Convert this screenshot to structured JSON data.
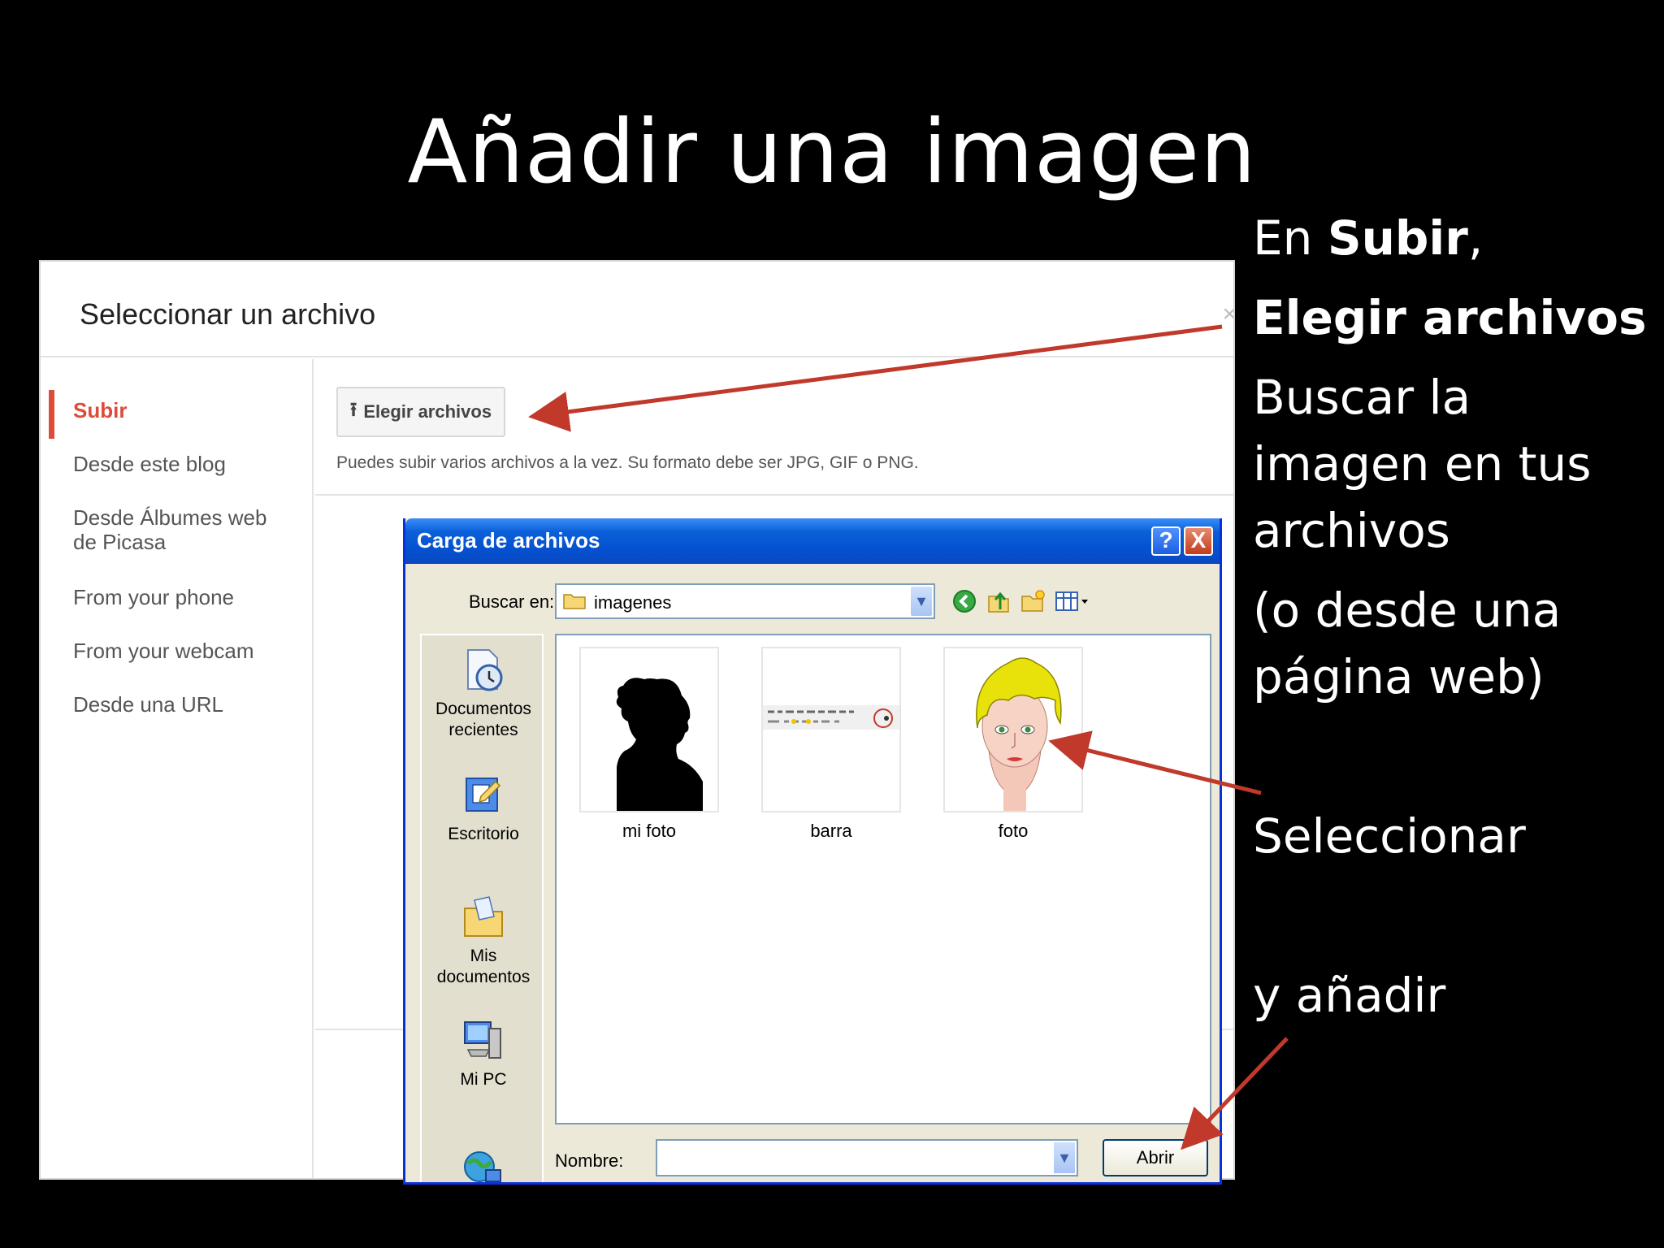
{
  "slide": {
    "title": "Añadir una imagen"
  },
  "notes": {
    "line1_prefix": "En ",
    "line1_bold": "Subir",
    "line1_suffix": ",",
    "line2_bold": "Elegir archivos",
    "line3": "Buscar la",
    "line4": "imagen en tus",
    "line5": "archivos",
    "line6": " (o desde una",
    "line7": "página web)",
    "line8": "Seleccionar",
    "line9": "y añadir"
  },
  "blogger": {
    "title": "Seleccionar un archivo",
    "close": "×",
    "sidebar": [
      {
        "label": "Subir",
        "active": true
      },
      {
        "label": "Desde este blog"
      },
      {
        "label": "Desde Álbumes web"
      },
      {
        "label": "de Picasa"
      },
      {
        "label": "From your phone"
      },
      {
        "label": "From your webcam"
      },
      {
        "label": "Desde una URL"
      }
    ],
    "upload_button": "Elegir archivos",
    "upload_hint": "Puedes subir varios archivos a la vez. Su formato debe ser JPG, GIF o PNG."
  },
  "dialog": {
    "title": "Carga de archivos",
    "help": "?",
    "close": "X",
    "lookin_label": "Buscar en:",
    "lookin_value": "imagenes",
    "places": [
      {
        "label_line1": "Documentos",
        "label_line2": "recientes",
        "icon": "recent-documents-icon"
      },
      {
        "label_line1": "Escritorio",
        "icon": "desktop-icon"
      },
      {
        "label_line1": "Mis documentos",
        "icon": "my-documents-icon"
      },
      {
        "label_line1": "Mi PC",
        "icon": "my-computer-icon"
      },
      {
        "icon": "network-places-icon"
      }
    ],
    "files": [
      {
        "label": "mi foto"
      },
      {
        "label": "barra"
      },
      {
        "label": "foto"
      }
    ],
    "name_label": "Nombre:",
    "name_value": "",
    "open_button": "Abrir"
  },
  "colors": {
    "accent_red": "#dd4b39",
    "arrow_red": "#c0392b",
    "xp_blue": "#0550d0"
  }
}
